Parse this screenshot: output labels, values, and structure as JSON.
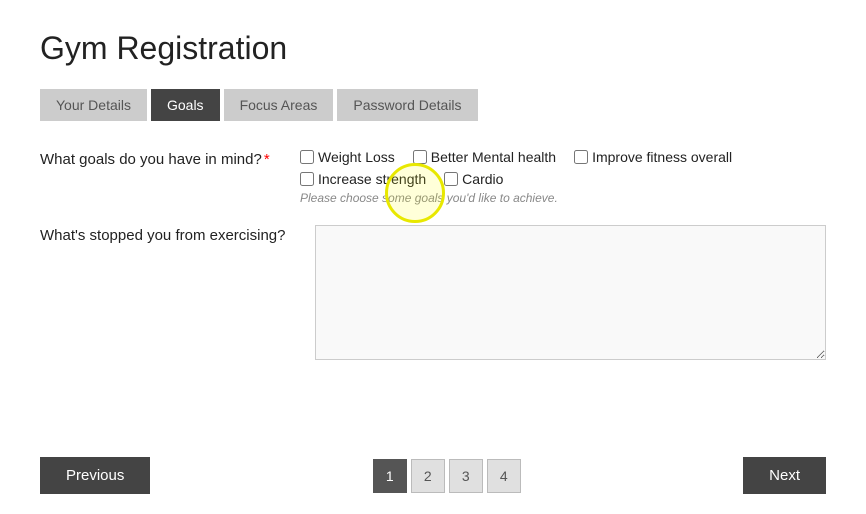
{
  "page": {
    "title": "Gym Registration"
  },
  "tabs": [
    {
      "id": "your-details",
      "label": "Your Details",
      "active": false
    },
    {
      "id": "goals",
      "label": "Goals",
      "active": true
    },
    {
      "id": "focus-areas",
      "label": "Focus Areas",
      "active": false
    },
    {
      "id": "password-details",
      "label": "Password Details",
      "active": false
    }
  ],
  "goals_question": {
    "label": "What goals do you have in mind?",
    "required": true,
    "hint": "Please choose some goals you'd like to achieve.",
    "options": [
      {
        "id": "weight-loss",
        "label": "Weight Loss",
        "checked": false
      },
      {
        "id": "better-mental-health",
        "label": "Better Mental health",
        "checked": false
      },
      {
        "id": "improve-fitness",
        "label": "Improve fitness overall",
        "checked": false
      },
      {
        "id": "increase-strength",
        "label": "Increase strength",
        "checked": false
      },
      {
        "id": "cardio",
        "label": "Cardio",
        "checked": false
      }
    ]
  },
  "stopped_question": {
    "label": "What's stopped you from exercising?",
    "placeholder": ""
  },
  "pagination": {
    "pages": [
      1,
      2,
      3,
      4
    ],
    "active_page": 2
  },
  "buttons": {
    "previous": "Previous",
    "next": "Next"
  }
}
